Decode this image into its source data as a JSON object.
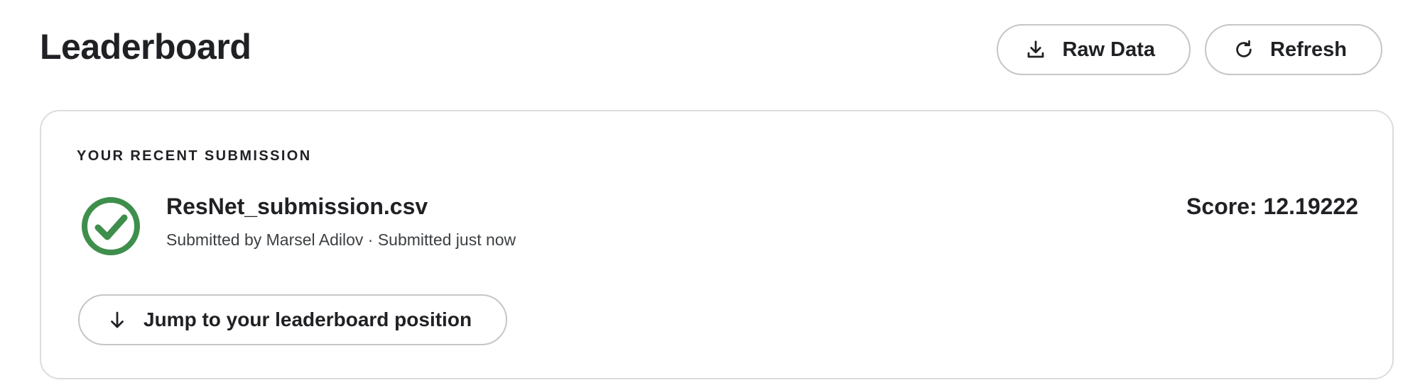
{
  "header": {
    "title": "Leaderboard",
    "actions": [
      {
        "label": "Raw Data",
        "icon": "download-icon"
      },
      {
        "label": "Refresh",
        "icon": "refresh-icon"
      }
    ]
  },
  "submission": {
    "section_label": "YOUR RECENT SUBMISSION",
    "status_icon": "check-circle-icon",
    "file_name": "ResNet_submission.csv",
    "meta": "Submitted by Marsel Adilov · Submitted just now",
    "score_text": "Score: 12.19222",
    "jump_button": {
      "label": "Jump to your leaderboard position",
      "icon": "arrow-down-icon"
    }
  },
  "colors": {
    "status_success": "#3e8e4c",
    "text_primary": "#202124",
    "border": "#dadce0"
  }
}
